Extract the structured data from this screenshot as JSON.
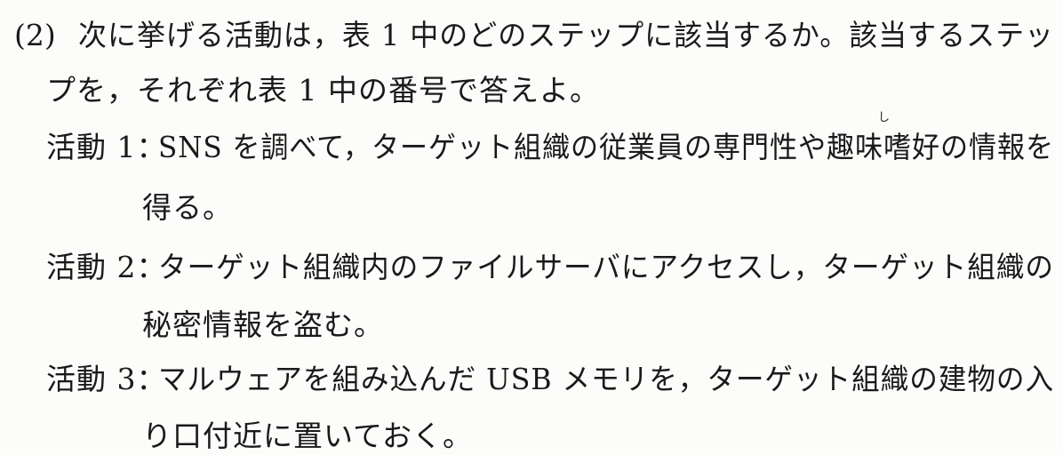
{
  "question": {
    "number": "(2)",
    "line1": "次に挙げる活動は，表 1 中のどのステップに該当するか。該当するステッ",
    "line2": "プを，それぞれ表 1 中の番号で答えよ。"
  },
  "activities": [
    {
      "label": "活動 1：",
      "line1": "SNS を調べて，ターゲット組織の従業員の専門性や趣味嗜好の情報を",
      "line2": "得る。",
      "ruby": "し"
    },
    {
      "label": "活動 2：",
      "line1": "ターゲット組織内のファイルサーバにアクセスし，ターゲット組織の",
      "line2": "秘密情報を盗む。"
    },
    {
      "label": "活動 3：",
      "line1": "マルウェアを組み込んだ USB メモリを，ターゲット組織の建物の入",
      "line2": "り口付近に置いておく。"
    }
  ]
}
